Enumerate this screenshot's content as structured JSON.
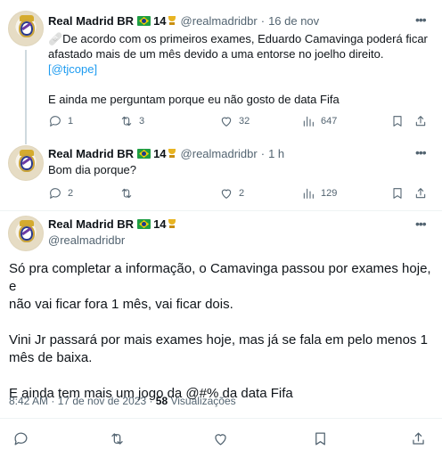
{
  "tweets": [
    {
      "name": "Real Madrid BR",
      "badge_count": "14",
      "handle": "@realmadridbr",
      "dot": "·",
      "time": "16 de nov",
      "text_line1": "🩹De acordo com os primeiros exames, Eduardo Camavinga poderá ficar",
      "text_line2": "afastado mais de um mês devido a uma entorse no joelho direito.",
      "link": "[@tjcope]",
      "text_line3": "E ainda me perguntam porque eu não gosto de data Fifa",
      "replies": "1",
      "retweets": "3",
      "likes": "32",
      "views": "647"
    },
    {
      "name": "Real Madrid BR",
      "badge_count": "14",
      "handle": "@realmadridbr",
      "dot": "·",
      "time": "1 h",
      "text_line1": "Bom dia porque?",
      "replies": "2",
      "retweets": "",
      "likes": "2",
      "views": "129"
    }
  ],
  "main_tweet": {
    "name": "Real Madrid BR",
    "badge_count": "14",
    "handle": "@realmadridbr",
    "para1_line1": "Só pra completar a informação, o Camavinga passou por exames hoje, e",
    "para1_line2": "não vai ficar fora 1 mês, vai ficar dois.",
    "para2_line1": "Vini Jr passará por mais exames hoje, mas já se fala em pelo menos 1",
    "para2_line2": "mês de baixa.",
    "para3": "E ainda tem mais um jogo da @#% da data Fifa",
    "timestamp": "8:42 AM · 17 de nov de 2023 · ",
    "views_count": "58",
    "views_label": " Visualizações"
  },
  "icons": {
    "more": "more-icon",
    "reply": "reply-icon",
    "retweet": "retweet-icon",
    "like": "heart-icon",
    "views": "views-icon",
    "bookmark": "bookmark-icon",
    "share": "share-icon"
  },
  "colors": {
    "link": "#1d9bf0",
    "secondary_text": "#536471",
    "primary_text": "#0f1419"
  }
}
